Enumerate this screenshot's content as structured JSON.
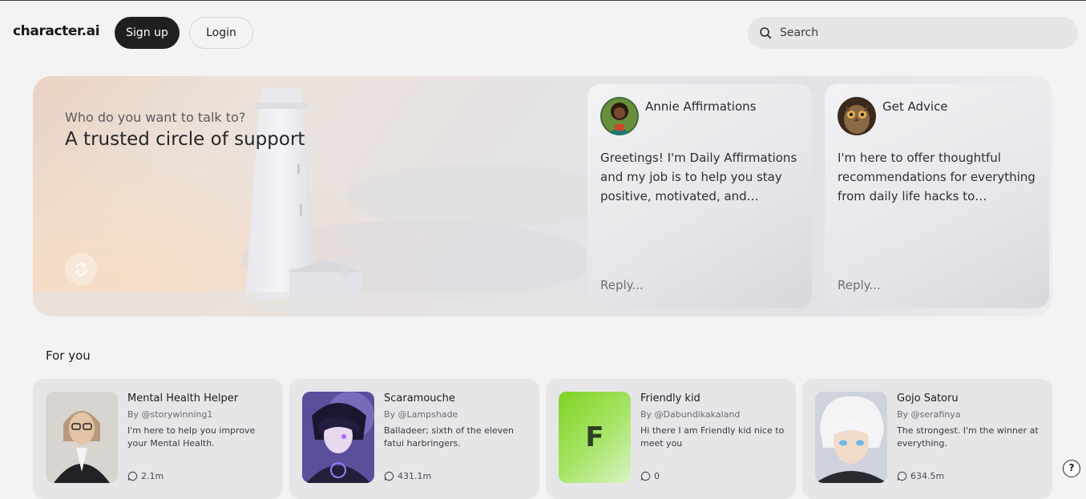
{
  "header": {
    "logo": "character.ai",
    "signup_label": "Sign up",
    "login_label": "Login",
    "search_placeholder": "Search"
  },
  "hero": {
    "question": "Who do you want to talk to?",
    "title": "A trusted circle of support",
    "cards": [
      {
        "name": "Annie Affirmations",
        "message": "Greetings! I'm Daily Affirmations and my job is to help you stay positive, motivated, and inspire...",
        "reply_placeholder": "Reply..."
      },
      {
        "name": "Get Advice",
        "message": "I'm here to offer thoughtful recommendations for everything from daily life hacks to complex...",
        "reply_placeholder": "Reply..."
      }
    ]
  },
  "for_you": {
    "title": "For you",
    "characters": [
      {
        "name": "Mental Health Helper",
        "by": "By @storywinning1",
        "description": "I'm here to help you improve your Mental Health.",
        "chats": "2.1m"
      },
      {
        "name": "Scaramouche",
        "by": "By @Lampshade",
        "description": "Balladeer; sixth of the eleven fatui harbringers.",
        "chats": "431.1m"
      },
      {
        "name": "Friendly kid",
        "by": "By @Dabundikakaland",
        "description": "Hi there I am Friendly kid nice to meet you",
        "chats": "0",
        "initial": "F"
      },
      {
        "name": "Gojo Satoru",
        "by": "By @serafinya",
        "description": "The strongest. I'm the winner at everything.",
        "chats": "634.5m"
      }
    ]
  },
  "help_label": "?",
  "colors": {
    "signup_bg": "#1f1f22",
    "search_bg": "#e6e6e8",
    "card_bg": "#e6e6e9",
    "friendly_kid_green": "#7ed321"
  }
}
